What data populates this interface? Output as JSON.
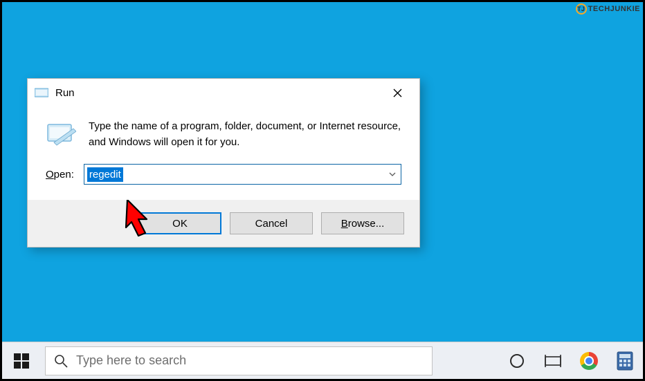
{
  "watermark": {
    "badge": "TJ",
    "text": "TECHJUNKIE"
  },
  "run_dialog": {
    "title": "Run",
    "description": "Type the name of a program, folder, document, or Internet resource, and Windows will open it for you.",
    "open_label_before": "O",
    "open_label_after": "pen:",
    "input_value": "regedit",
    "buttons": {
      "ok": "OK",
      "cancel": "Cancel",
      "browse_underline": "B",
      "browse_rest": "rowse..."
    }
  },
  "taskbar": {
    "search_placeholder": "Type here to search"
  }
}
